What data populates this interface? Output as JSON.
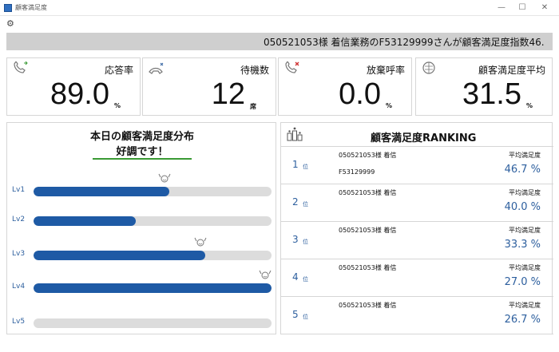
{
  "window": {
    "title": "顧客満足度",
    "minimize": "—",
    "maximize": "☐",
    "close": "✕"
  },
  "toolbar": {
    "settings_icon": "gear-icon"
  },
  "ticker": {
    "text": "050521053様 着信業務のF53129999さんが顧客満足度指数46."
  },
  "kpis": [
    {
      "label": "応答率",
      "value": "89.0",
      "unit": "%",
      "icon": "phone-incoming-icon"
    },
    {
      "label": "待機数",
      "value": "12",
      "unit": "席",
      "icon": "phone-waiting-icon"
    },
    {
      "label": "放棄呼率",
      "value": "0.0",
      "unit": "%",
      "icon": "phone-abandoned-icon"
    },
    {
      "label": "顧客満足度平均",
      "value": "31.5",
      "unit": "%",
      "icon": "satisfaction-icon"
    }
  ],
  "distribution": {
    "title": "本日の顧客満足度分布",
    "subtitle": "好調です！",
    "levels": [
      {
        "label": "Lv1",
        "fill": 0.57,
        "face": true
      },
      {
        "label": "Lv2",
        "fill": 0.43,
        "face": false
      },
      {
        "label": "Lv3",
        "fill": 0.72,
        "face": true
      },
      {
        "label": "Lv4",
        "fill": 1.0,
        "face": true
      },
      {
        "label": "Lv5",
        "fill": 0.0,
        "face": false
      }
    ]
  },
  "ranking": {
    "title": "顧客満足度RANKING",
    "rank_suffix": "位",
    "avg_label": "平均満足度",
    "rows": [
      {
        "rank": "1",
        "caller": "050521053様 着信",
        "agent": "F53129999",
        "score": "46.7 %"
      },
      {
        "rank": "2",
        "caller": "050521053様 着信",
        "agent": "",
        "score": "40.0 %"
      },
      {
        "rank": "3",
        "caller": "050521053様 着信",
        "agent": "",
        "score": "33.3 %"
      },
      {
        "rank": "4",
        "caller": "050521053様 着信",
        "agent": "",
        "score": "27.0 %"
      },
      {
        "rank": "5",
        "caller": "050521053様 着信",
        "agent": "",
        "score": "26.7 %"
      }
    ]
  },
  "colors": {
    "accent": "#1e5aa5",
    "label_blue": "#2d5f9e",
    "track": "#dcdcdc",
    "underline_green": "#3a9a34",
    "ticker_bg": "#cfcfcf",
    "alert_red": "#d03030"
  }
}
